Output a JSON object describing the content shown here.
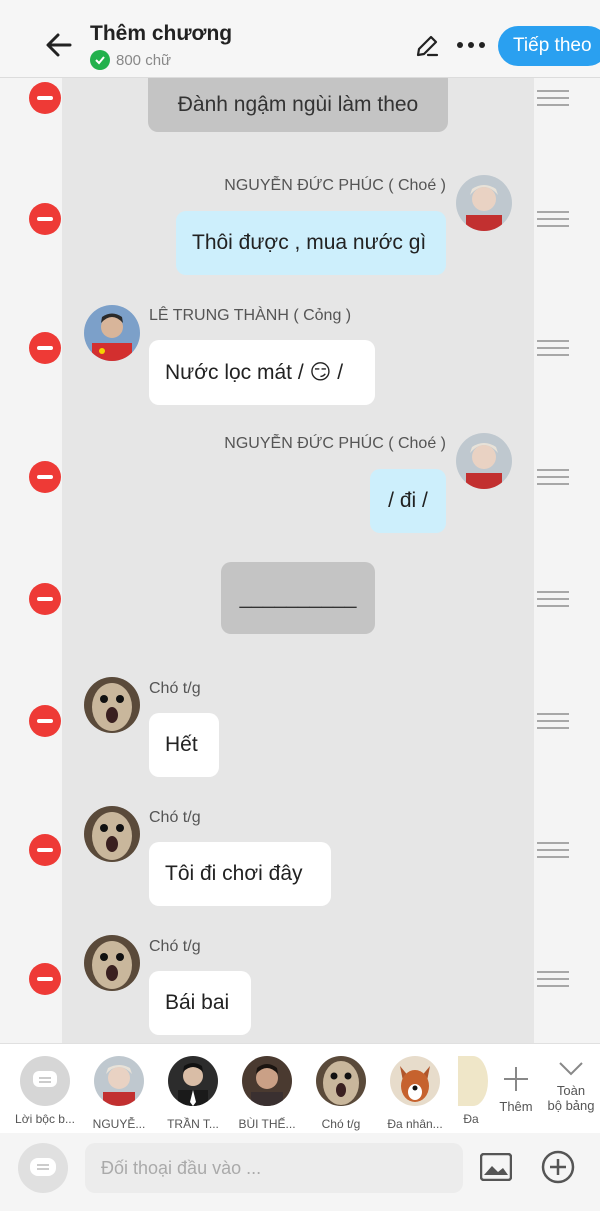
{
  "header": {
    "title": "Thêm chương",
    "word_count": "800 chữ",
    "next_button": "Tiếp theo"
  },
  "messages": [
    {
      "type": "narration",
      "text": "Đành ngậm ngùi làm theo"
    },
    {
      "type": "right",
      "name": "NGUYỄN ĐỨC PHÚC ( Choé )",
      "text": "Thôi được , mua nước gì"
    },
    {
      "type": "left",
      "name": "LÊ TRUNG THÀNH ( Cỏng )",
      "text": "Nước lọc mát / 😏 /"
    },
    {
      "type": "right",
      "name": "NGUYỄN ĐỨC PHÚC ( Choé )",
      "text": "/ đi /"
    },
    {
      "type": "narration",
      "text": "__________"
    },
    {
      "type": "left",
      "name": "Chó t/g",
      "text": "Hết"
    },
    {
      "type": "left",
      "name": "Chó t/g",
      "text": "Tôi đi chơi đây"
    },
    {
      "type": "left",
      "name": "Chó t/g",
      "text": "Bái bai"
    }
  ],
  "characters": [
    {
      "label": "Lời bộc b..."
    },
    {
      "label": "NGUYỄ..."
    },
    {
      "label": "TRẦN T..."
    },
    {
      "label": "BÙI THẾ..."
    },
    {
      "label": "Chó t/g"
    },
    {
      "label": "Đa nhân..."
    },
    {
      "label": "Đa"
    }
  ],
  "char_actions": {
    "add": "Thêm",
    "all_board_1": "Toàn",
    "all_board_2": "bộ bảng"
  },
  "input": {
    "placeholder": "Đối thoại đầu vào ..."
  },
  "colors": {
    "accent": "#2aa0f0",
    "delete": "#ee3a36",
    "right_bubble": "#cdeffc",
    "narration": "#c4c4c4"
  }
}
